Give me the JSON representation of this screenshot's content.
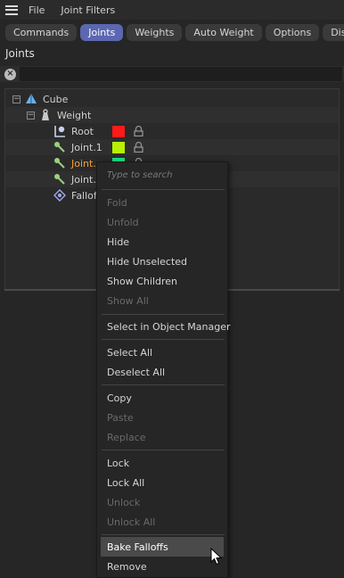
{
  "menubar": {
    "items": [
      "File",
      "Joint Filters"
    ]
  },
  "tabs": [
    {
      "label": "Commands",
      "active": false
    },
    {
      "label": "Joints",
      "active": true
    },
    {
      "label": "Weights",
      "active": false
    },
    {
      "label": "Auto Weight",
      "active": false
    },
    {
      "label": "Options",
      "active": false
    },
    {
      "label": "Display",
      "active": false
    }
  ],
  "panel": {
    "title": "Joints"
  },
  "search": {
    "value": ""
  },
  "tree": [
    {
      "label": "Cube",
      "icon": "polygon-object-icon",
      "swatch": null,
      "lock": false
    },
    {
      "label": "Weight",
      "icon": "weight-tag-icon",
      "swatch": null,
      "lock": false
    },
    {
      "label": "Root",
      "icon": "root-joint-icon",
      "swatch": "#ff1a1a",
      "lock": true
    },
    {
      "label": "Joint.1",
      "icon": "joint-icon",
      "swatch": "#b8f000",
      "lock": true
    },
    {
      "label": "Joint.",
      "icon": "joint-icon",
      "swatch": "#18e080",
      "lock": true,
      "selected": true
    },
    {
      "label": "Joint.",
      "icon": "joint-icon",
      "swatch": null,
      "lock": false
    },
    {
      "label": "Fallof",
      "icon": "falloff-icon",
      "swatch": null,
      "lock": false
    }
  ],
  "context_menu": {
    "search_placeholder": "Type to search",
    "groups": [
      [
        {
          "label": "Fold",
          "enabled": false
        },
        {
          "label": "Unfold",
          "enabled": false
        },
        {
          "label": "Hide",
          "enabled": true
        },
        {
          "label": "Hide Unselected",
          "enabled": true
        },
        {
          "label": "Show Children",
          "enabled": true
        },
        {
          "label": "Show All",
          "enabled": false
        }
      ],
      [
        {
          "label": "Select in Object Manager",
          "enabled": true
        }
      ],
      [
        {
          "label": "Select All",
          "enabled": true
        },
        {
          "label": "Deselect All",
          "enabled": true
        }
      ],
      [
        {
          "label": "Copy",
          "enabled": true
        },
        {
          "label": "Paste",
          "enabled": false
        },
        {
          "label": "Replace",
          "enabled": false
        }
      ],
      [
        {
          "label": "Lock",
          "enabled": true
        },
        {
          "label": "Lock All",
          "enabled": true
        },
        {
          "label": "Unlock",
          "enabled": false
        },
        {
          "label": "Unlock All",
          "enabled": false
        }
      ],
      [
        {
          "label": "Bake Falloffs",
          "enabled": true,
          "highlighted": true
        },
        {
          "label": "Remove",
          "enabled": true
        }
      ]
    ]
  }
}
